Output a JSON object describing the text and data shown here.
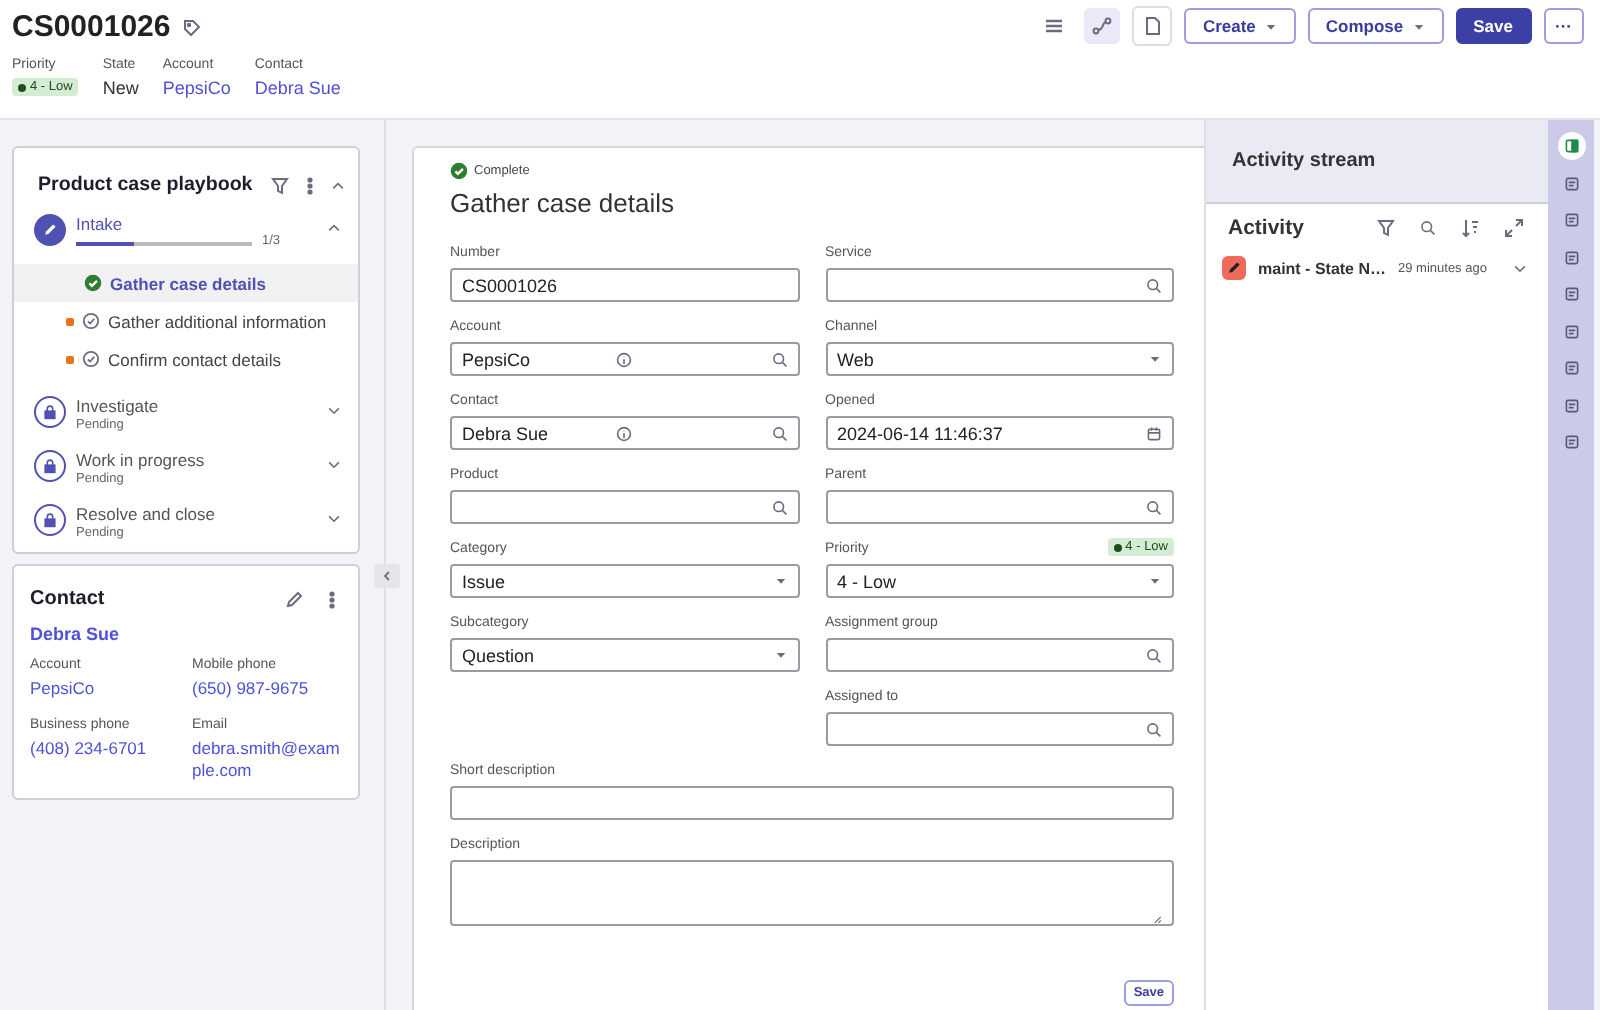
{
  "header": {
    "title": "CS0001026",
    "fields": [
      {
        "label": "Priority",
        "value": "4 - Low",
        "kind": "badge"
      },
      {
        "label": "State",
        "value": "New",
        "kind": "text"
      },
      {
        "label": "Account",
        "value": "PepsiCo",
        "kind": "link"
      },
      {
        "label": "Contact",
        "value": "Debra Sue",
        "kind": "link"
      }
    ],
    "tools": [
      {
        "kind": "list",
        "selected": false,
        "disabled": false
      },
      {
        "kind": "flow",
        "selected": true,
        "disabled": false
      },
      {
        "kind": "doc",
        "selected": false,
        "disabled": true
      }
    ],
    "actions": [
      {
        "label": "Create",
        "kind": "menu"
      },
      {
        "label": "Compose",
        "kind": "menu"
      },
      {
        "label": "Save",
        "kind": "primary"
      },
      {
        "label": "···",
        "kind": "more"
      }
    ]
  },
  "playbook": {
    "title": "Product case playbook",
    "stages": [
      {
        "name": "Intake",
        "kind": "active",
        "expanded": true,
        "level": 0.33,
        "progress": "1/3",
        "tasks": [
          {
            "name": "Gather case details",
            "kind": "complete",
            "selected": true,
            "required": false
          },
          {
            "name": "Gather additional information",
            "kind": "open",
            "selected": false,
            "required": true
          },
          {
            "name": "Confirm contact details",
            "kind": "open",
            "selected": false,
            "required": true
          }
        ]
      },
      {
        "name": "Investigate",
        "kind": "pending",
        "label": "Pending",
        "expanded": false
      },
      {
        "name": "Work in progress",
        "kind": "pending",
        "label": "Pending",
        "expanded": false
      },
      {
        "name": "Resolve and close",
        "kind": "pending",
        "label": "Pending",
        "expanded": false
      }
    ]
  },
  "contact": {
    "title": "Contact",
    "name": "Debra Sue",
    "fields": [
      {
        "label": "Account",
        "value": "PepsiCo"
      },
      {
        "label": "Mobile phone",
        "value": "(650) 987-9675"
      },
      {
        "label": "Business phone",
        "value": "(408) 234-6701"
      },
      {
        "label": "Email",
        "value": "debra.smith@example.com"
      }
    ]
  },
  "form": {
    "status": "Complete",
    "title": "Gather case details",
    "rows": [
      {
        "left": {
          "label": "Number",
          "value": "CS0001026",
          "kind": "text"
        },
        "right": {
          "label": "Service",
          "kind": "lookup"
        }
      },
      {
        "left": {
          "label": "Account",
          "value": "PepsiCo",
          "kind": "lookup",
          "info": true
        },
        "right": {
          "label": "Channel",
          "value": "Web",
          "kind": "select"
        }
      },
      {
        "left": {
          "label": "Contact",
          "value": "Debra Sue",
          "kind": "lookup",
          "info": true
        },
        "right": {
          "label": "Opened",
          "value": "2024-06-14 11:46:37",
          "kind": "datetime"
        }
      },
      {
        "left": {
          "label": "Product",
          "kind": "lookup"
        },
        "right": {
          "label": "Parent",
          "kind": "lookup"
        }
      },
      {
        "left": {
          "label": "Category",
          "value": "Issue",
          "kind": "select"
        },
        "right": {
          "label": "Priority",
          "value": "4 - Low",
          "kind": "select",
          "badge": "4 - Low"
        }
      },
      {
        "left": {
          "label": "Subcategory",
          "value": "Question",
          "kind": "select"
        },
        "right": {
          "label": "Assignment group",
          "kind": "lookup"
        }
      },
      {
        "right": {
          "label": "Assigned to",
          "kind": "lookup"
        }
      }
    ],
    "wide": [
      {
        "label": "Short description",
        "kind": "text"
      },
      {
        "label": "Description",
        "kind": "textarea"
      }
    ],
    "save": "Save"
  },
  "activity": {
    "panel_title": "Activity stream",
    "title": "Activity",
    "entries": [
      {
        "text": "maint - State N…",
        "time": "29 minutes ago"
      }
    ]
  },
  "rail": [
    {
      "selected": true
    },
    {
      "selected": false
    },
    {
      "selected": false
    },
    {
      "selected": false
    },
    {
      "selected": false
    },
    {
      "selected": false
    },
    {
      "selected": false
    },
    {
      "selected": false
    },
    {
      "selected": false
    }
  ]
}
